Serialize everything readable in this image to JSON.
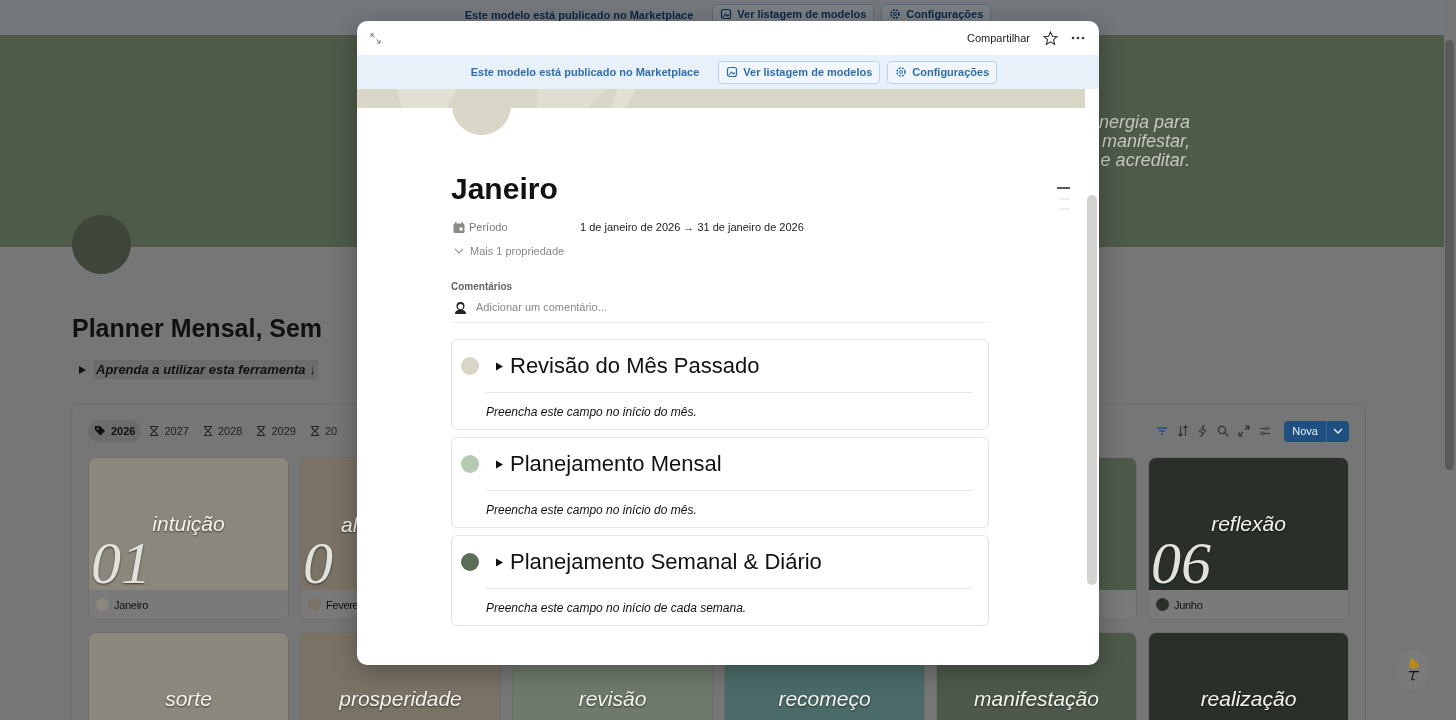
{
  "page": {
    "banner": {
      "text": "Este modelo está publicado no Marketplace",
      "buttons": [
        {
          "label": "Ver listagem de modelos",
          "kind": "gallery"
        },
        {
          "label": "Configurações",
          "kind": "gear"
        }
      ]
    },
    "cover_quote": [
      "nergia para",
      "manifestar,",
      "e acreditar."
    ],
    "title": "Planner Mensal, Sem",
    "toggle": {
      "label": "Aprenda a utilizar esta ferramenta ↓",
      "expanded": false
    },
    "board": {
      "tabs": [
        {
          "label": "2026",
          "kind": "tag",
          "selected": true
        },
        {
          "label": "2027",
          "kind": "hourglass",
          "selected": false
        },
        {
          "label": "2028",
          "kind": "hourglass",
          "selected": false
        },
        {
          "label": "2029",
          "kind": "hourglass",
          "selected": false
        },
        {
          "label": "20",
          "kind": "hourglass",
          "selected": false
        }
      ],
      "new_button": "Nova",
      "cards": [
        {
          "number": "01",
          "word": "intuição",
          "name": "Janeiro",
          "color": "#8b877c"
        },
        {
          "number": "0",
          "word": "al",
          "name": "Fevere",
          "color": "#7a7264"
        },
        {
          "color": "#4d5a4a"
        },
        {
          "number": "06",
          "word": "reflexão",
          "name": "Junho",
          "color": "#2a2f29"
        },
        {
          "word": "sorte",
          "color": "#8b877c"
        },
        {
          "word": "prosperidade",
          "color": "#7a7264"
        },
        {
          "word": "revisão",
          "color": "#6f7a6b"
        },
        {
          "word": "recomeço",
          "color": "#4b6b68"
        },
        {
          "word": "manifestação",
          "color": "#4d5a4a"
        },
        {
          "word": "realização",
          "color": "#2a2f29"
        }
      ]
    }
  },
  "modal": {
    "share": "Compartilhar",
    "banner": {
      "text": "Este modelo está publicado no Marketplace",
      "buttons": [
        {
          "label": "Ver listagem de modelos",
          "kind": "gallery"
        },
        {
          "label": "Configurações",
          "kind": "gear"
        }
      ]
    },
    "title": "Janeiro",
    "properties": [
      {
        "label": "Período",
        "value": "1 de janeiro de 2026 → 31 de janeiro de 2026"
      }
    ],
    "more_properties": "Mais 1 propriedade",
    "comments": {
      "heading": "Comentários",
      "placeholder": "Adicionar um comentário..."
    },
    "callouts": [
      {
        "title": "Revisão do Mês Passado",
        "text": "Preencha este campo no início do mês.",
        "color": "#d8d6c6",
        "expanded": false
      },
      {
        "title": "Planejamento Mensal",
        "text": "Preencha este campo no início do mês.",
        "color": "#b5c9b3",
        "expanded": false
      },
      {
        "title": "Planejamento Semanal & Diário",
        "text": "Preencha este campo no início de cada semana.",
        "color": "#5b6c57",
        "expanded": false
      }
    ]
  }
}
